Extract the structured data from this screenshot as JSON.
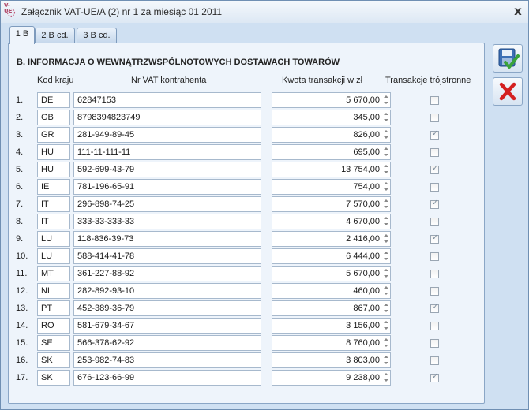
{
  "window": {
    "title": "Załącznik VAT-UE/A (2) nr 1 za miesiąc 01 2011",
    "icon_tag": "V-UE",
    "close_glyph": "x"
  },
  "tabs": [
    {
      "label": "1 B",
      "active": true
    },
    {
      "label": "2 B cd.",
      "active": false
    },
    {
      "label": "3 B cd.",
      "active": false
    }
  ],
  "section": {
    "title": "B. INFORMACJA O WEWNĄTRZWSPÓLNOTOWYCH DOSTAWACH TOWARÓW"
  },
  "columns": {
    "country": "Kod kraju",
    "vat": "Nr VAT kontrahenta",
    "amount": "Kwota transakcji w zł",
    "triangular": "Transakcje trójstronne"
  },
  "rows": [
    {
      "num": "1.",
      "country": "DE",
      "vat": "62847153",
      "amount": "5 670,00",
      "triangular": false
    },
    {
      "num": "2.",
      "country": "GB",
      "vat": "8798394823749",
      "amount": "345,00",
      "triangular": false
    },
    {
      "num": "3.",
      "country": "GR",
      "vat": "281-949-89-45",
      "amount": "826,00",
      "triangular": true
    },
    {
      "num": "4.",
      "country": "HU",
      "vat": "111-11-111-11",
      "amount": "695,00",
      "triangular": false
    },
    {
      "num": "5.",
      "country": "HU",
      "vat": "592-699-43-79",
      "amount": "13 754,00",
      "triangular": true
    },
    {
      "num": "6.",
      "country": "IE",
      "vat": "781-196-65-91",
      "amount": "754,00",
      "triangular": false
    },
    {
      "num": "7.",
      "country": "IT",
      "vat": "296-898-74-25",
      "amount": "7 570,00",
      "triangular": true
    },
    {
      "num": "8.",
      "country": "IT",
      "vat": "333-33-333-33",
      "amount": "4 670,00",
      "triangular": false
    },
    {
      "num": "9.",
      "country": "LU",
      "vat": "118-836-39-73",
      "amount": "2 416,00",
      "triangular": true
    },
    {
      "num": "10.",
      "country": "LU",
      "vat": "588-414-41-78",
      "amount": "6 444,00",
      "triangular": false
    },
    {
      "num": "11.",
      "country": "MT",
      "vat": "361-227-88-92",
      "amount": "5 670,00",
      "triangular": false
    },
    {
      "num": "12.",
      "country": "NL",
      "vat": "282-892-93-10",
      "amount": "460,00",
      "triangular": false
    },
    {
      "num": "13.",
      "country": "PT",
      "vat": "452-389-36-79",
      "amount": "867,00",
      "triangular": true
    },
    {
      "num": "14.",
      "country": "RO",
      "vat": "581-679-34-67",
      "amount": "3 156,00",
      "triangular": false
    },
    {
      "num": "15.",
      "country": "SE",
      "vat": "566-378-62-92",
      "amount": "8 760,00",
      "triangular": false
    },
    {
      "num": "16.",
      "country": "SK",
      "vat": "253-982-74-83",
      "amount": "3 803,00",
      "triangular": false
    },
    {
      "num": "17.",
      "country": "SK",
      "vat": "676-123-66-99",
      "amount": "9 238,00",
      "triangular": true
    }
  ],
  "side_buttons": [
    {
      "icon": "save-confirm-icon"
    },
    {
      "icon": "cancel-x-icon"
    }
  ],
  "colors": {
    "accent": "#cfe0f2",
    "cancel": "#d42020",
    "check": "#3aa33a"
  }
}
